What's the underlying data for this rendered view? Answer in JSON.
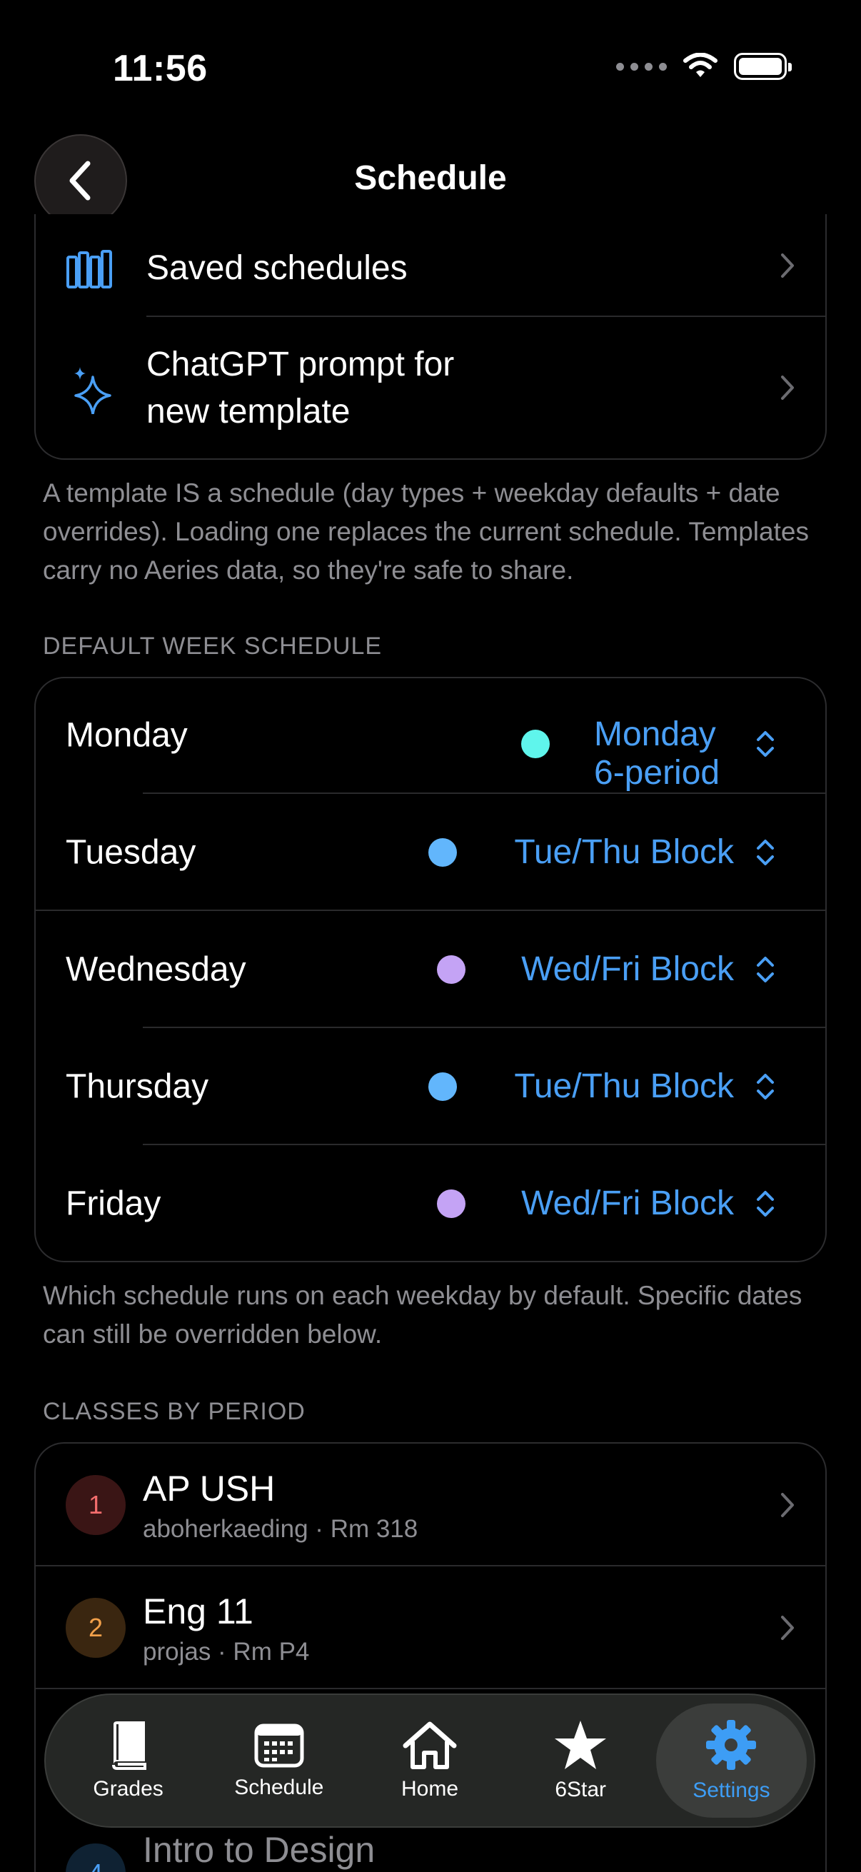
{
  "status_bar": {
    "time": "11:56"
  },
  "header": {
    "title": "Schedule"
  },
  "template_section": {
    "items": [
      {
        "label": "Saved schedules",
        "icon": "books-icon"
      },
      {
        "label": "ChatGPT prompt for new template",
        "icon": "sparkles-icon"
      }
    ],
    "footer": "A template IS a schedule (day types + weekday defaults + date overrides). Loading one replaces the current schedule. Templates carry no Aeries data, so they're safe to share."
  },
  "default_week": {
    "header": "DEFAULT WEEK SCHEDULE",
    "days": [
      {
        "day": "Monday",
        "schedule": "Monday 6-period",
        "color": "#5ff5ec"
      },
      {
        "day": "Tuesday",
        "schedule": "Tue/Thu Block",
        "color": "#62b6fc"
      },
      {
        "day": "Wednesday",
        "schedule": "Wed/Fri Block",
        "color": "#c4a3f5"
      },
      {
        "day": "Thursday",
        "schedule": "Tue/Thu Block",
        "color": "#62b6fc"
      },
      {
        "day": "Friday",
        "schedule": "Wed/Fri Block",
        "color": "#c4a3f5"
      }
    ],
    "footer": "Which schedule runs on each weekday by default. Specific dates can still be overridden below."
  },
  "classes": {
    "header": "CLASSES BY PERIOD",
    "items": [
      {
        "period": "1",
        "name": "AP USH",
        "sub": "aboherkaeding · Rm 318",
        "color": "#f26d6d",
        "bg": "#3a1515"
      },
      {
        "period": "2",
        "name": "Eng 11",
        "sub": "projas · Rm P4",
        "color": "#f2a04a",
        "bg": "#3a2610"
      },
      {
        "period": "4",
        "name": "Intro to Design"
      }
    ]
  },
  "tabbar": {
    "tabs": [
      {
        "label": "Grades",
        "icon": "book-icon"
      },
      {
        "label": "Schedule",
        "icon": "calendar-icon"
      },
      {
        "label": "Home",
        "icon": "house-icon"
      },
      {
        "label": "6Star",
        "icon": "star-icon"
      },
      {
        "label": "Settings",
        "icon": "gear-icon",
        "active": true
      }
    ]
  },
  "colors": {
    "accent": "#4a9ff5",
    "background": "#000000",
    "secondary_text": "#8e8e93"
  }
}
